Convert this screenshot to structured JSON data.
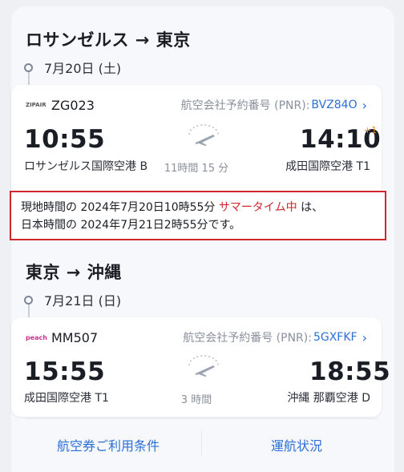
{
  "segments": [
    {
      "route_title": "ロサンゼルス → 東京",
      "date": "7月20日 (土)",
      "airline_logo": "ZIPAIR",
      "flight_no": "ZG023",
      "pnr_label": "航空会社予約番号 (PNR):",
      "pnr_code": "BVZ84O",
      "dep_time": "10:55",
      "arr_time": "14:10",
      "day_offset": "+1",
      "dep_airport": "ロサンゼルス国際空港 B",
      "arr_airport": "成田国際空港 T1",
      "duration": "11時間 15 分"
    },
    {
      "route_title": "東京 → 沖縄",
      "date": "7月21日 (日)",
      "airline_logo": "peach",
      "flight_no": "MM507",
      "pnr_label": "航空会社予約番号 (PNR):",
      "pnr_code": "5GXFKF",
      "dep_time": "15:55",
      "arr_time": "18:55",
      "dep_airport": "成田国際空港 T1",
      "arr_airport": "沖縄 那覇空港 D",
      "duration": "3 時間"
    }
  ],
  "notice": {
    "part1": "現地時間の 2024年7月20日10時55分 ",
    "highlight": "サマータイム中",
    "part2": " は、",
    "line2": "日本時間の 2024年7月21日2時55分です。"
  },
  "footer": {
    "terms_link": "航空券ご利用条件",
    "status_link": "運航状況"
  },
  "colors": {
    "accent": "#2a6fd6",
    "notice_border": "#d0262e",
    "day_offset": "#e38b1c"
  },
  "icons": [
    "chevron-right-icon",
    "airplane-icon",
    "timeline-dot-icon"
  ]
}
